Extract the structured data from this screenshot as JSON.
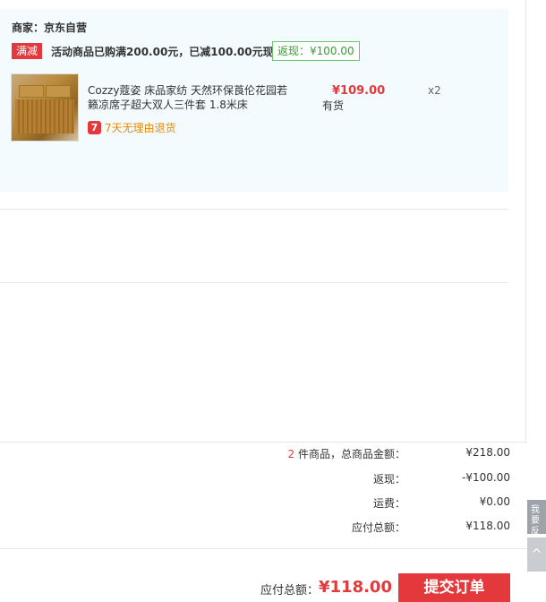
{
  "shop": {
    "seller": "商家：京东自营",
    "promo_tag": "满减",
    "promo_text": "活动商品已购满200.00元，已减100.00元现金",
    "rebate_badge": "返现：¥100.00"
  },
  "item": {
    "name": "Cozzy蔻姿 床品家纺 天然环保莨伦花园若籁凉席子超大双人三件套 1.8米床",
    "price": "¥109.00",
    "stock": "有货",
    "qty": "x2",
    "return_icon": "7",
    "return_text": "7天无理由退货",
    "image_icon": "bamboo-mat-product-image"
  },
  "summary": {
    "count": "2",
    "count_suffix": " 件商品，总商品金额：",
    "goods_total": "¥218.00",
    "rebate_label": "返现：",
    "rebate_value": "-¥100.00",
    "shipping_label": "运费：",
    "shipping_value": "¥0.00",
    "payable_label": "应付总额：",
    "payable_value": "¥118.00"
  },
  "footer": {
    "pay_label": "应付总额：",
    "pay_amount": "¥118.00",
    "submit_label": "提交订单"
  },
  "side": {
    "feedback": "我要反馈",
    "top_icon": "arrow-up-icon",
    "top_glyph": "^"
  },
  "colors": {
    "accent": "#e4393c",
    "rebate_green": "#3a9a3a",
    "return_orange": "#e88a00",
    "panel_bg": "#f3fbfe"
  }
}
